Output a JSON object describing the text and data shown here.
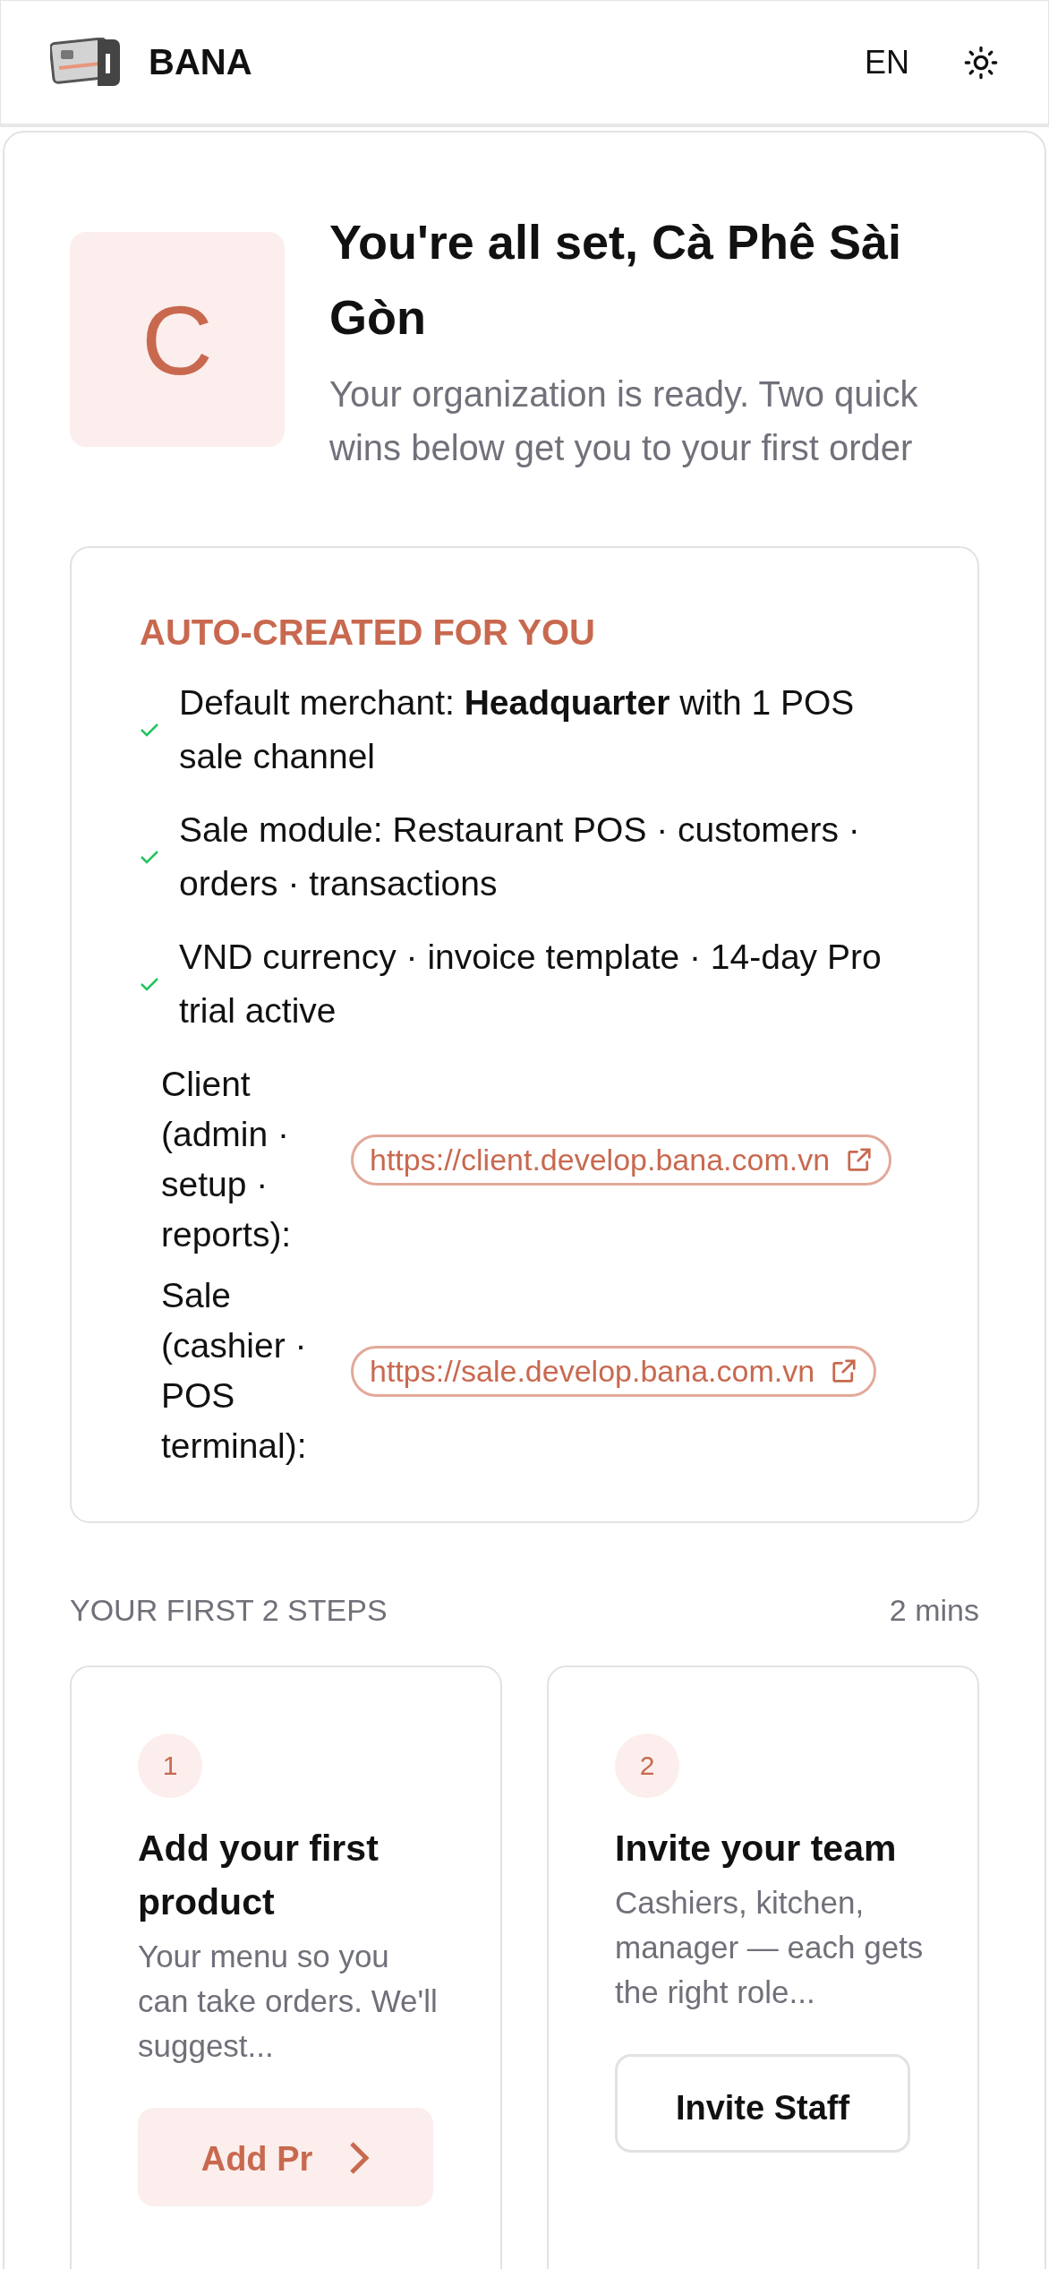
{
  "header": {
    "brand": "BANA",
    "language": "EN"
  },
  "welcome": {
    "avatar_letter": "C",
    "title": "You're all set, Cà Phê Sài Gòn",
    "subtitle": "Your organization is ready. Two quick wins below get you to your first order"
  },
  "auto_created": {
    "heading": "AUTO-CREATED FOR YOU",
    "items": [
      {
        "text": "Default merchant: **Headquarter** with 1 POS sale channel",
        "checked": true
      },
      {
        "text": "Sale module: Restaurant POS · customers · orders · transactions",
        "checked": true
      },
      {
        "text": "VND currency · invoice template · 14-day Pro trial active",
        "checked": true
      }
    ],
    "links": [
      {
        "label": "Client (admin · setup · reports):",
        "url": "https://client.develop.bana.com.vn"
      },
      {
        "label": "Sale (cashier · POS terminal):",
        "url": "https://sale.develop.bana.com.vn"
      }
    ]
  },
  "steps": {
    "heading": "YOUR FIRST 2 STEPS",
    "duration": "2 mins",
    "items": [
      {
        "number": "1",
        "title": "Add your first product",
        "description": "Your menu so you can take orders. We'll suggest...",
        "button": "Add Pr",
        "kind": "primary"
      },
      {
        "number": "2",
        "title": "Invite your team",
        "description": "Cashiers, kitchen, manager — each gets the right role...",
        "button": "Invite Staff",
        "kind": "secondary"
      }
    ]
  }
}
